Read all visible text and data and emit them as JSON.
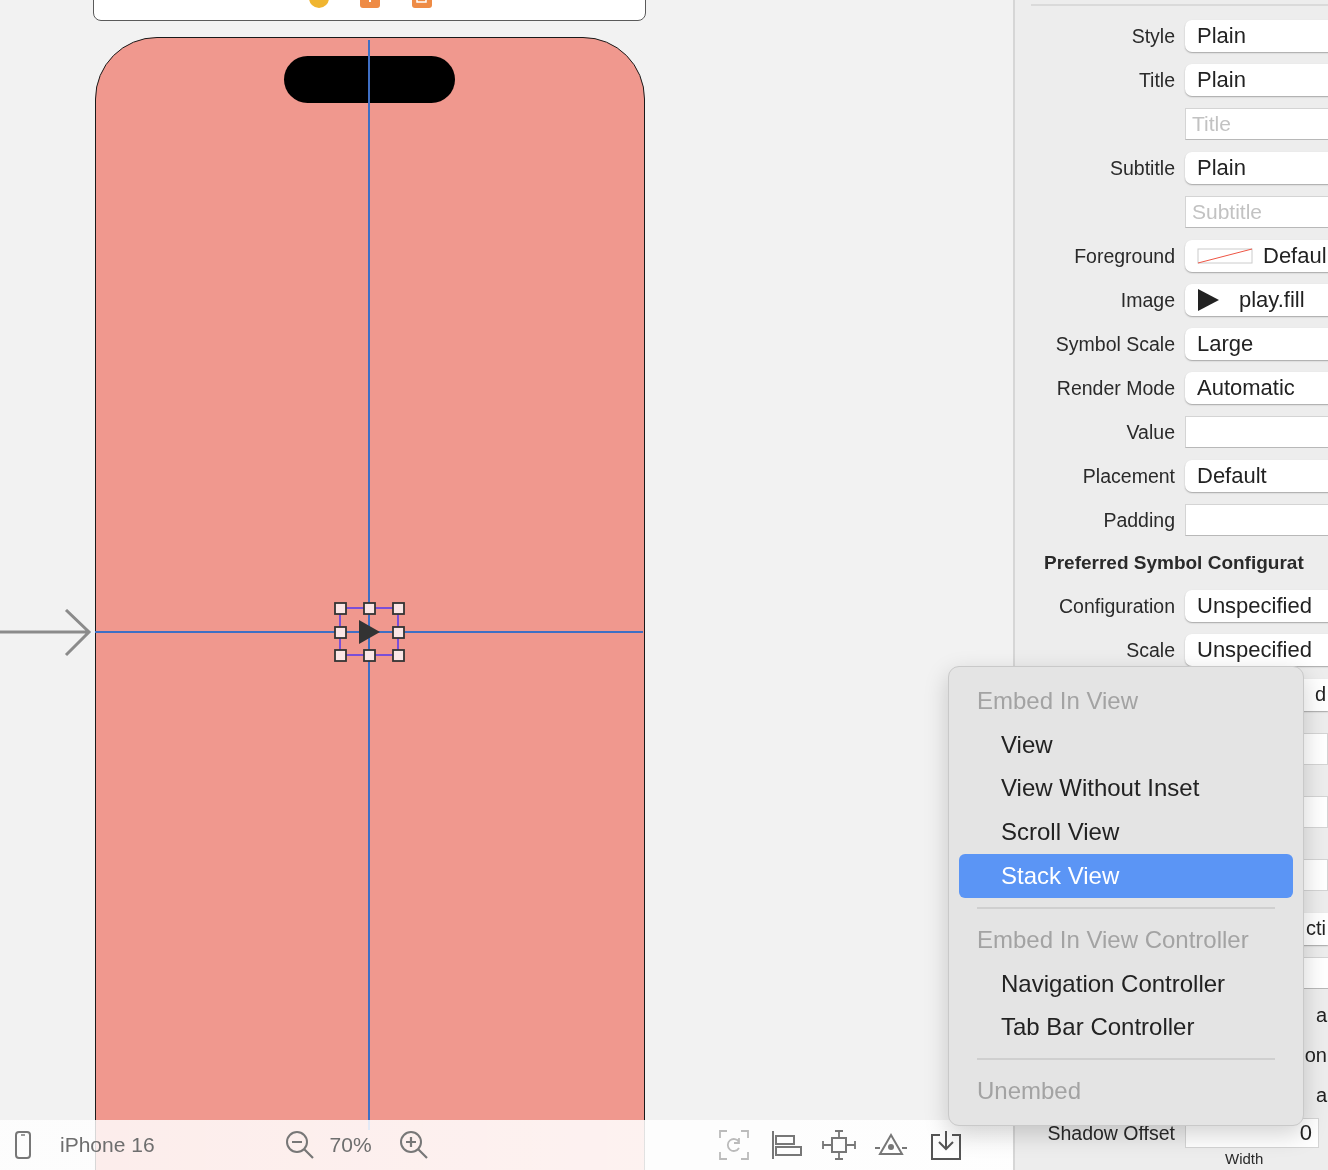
{
  "device": {
    "name": "iPhone 16",
    "zoom": "70%"
  },
  "inspector": {
    "rows": [
      {
        "kind": "popup",
        "label": "Style",
        "value": "Plain"
      },
      {
        "kind": "popup",
        "label": "Title",
        "value": "Plain"
      },
      {
        "kind": "text",
        "placeholder": "Title"
      },
      {
        "kind": "popup",
        "label": "Subtitle",
        "value": "Plain"
      },
      {
        "kind": "text",
        "placeholder": "Subtitle"
      },
      {
        "kind": "color",
        "label": "Foreground",
        "value": "Defaul"
      },
      {
        "kind": "image",
        "label": "Image",
        "value": "play.fill"
      },
      {
        "kind": "popup",
        "label": "Symbol Scale",
        "value": "Large"
      },
      {
        "kind": "popup",
        "label": "Render Mode",
        "value": "Automatic"
      },
      {
        "kind": "text",
        "label": "Value"
      },
      {
        "kind": "popup",
        "label": "Placement",
        "value": "Default"
      },
      {
        "kind": "text",
        "label": "Padding"
      },
      {
        "kind": "heading",
        "label": "Preferred Symbol Configurat"
      },
      {
        "kind": "popup",
        "label": "Configuration",
        "value": "Unspecified"
      },
      {
        "kind": "popup",
        "label": "Scale",
        "value": "Unspecified"
      },
      {
        "kind": "tail",
        "value": "d"
      },
      {
        "kind": "blank"
      },
      {
        "kind": "blank"
      },
      {
        "kind": "blank"
      },
      {
        "kind": "tail",
        "value": "cti"
      },
      {
        "kind": "text"
      },
      {
        "kind": "note",
        "value": "a"
      },
      {
        "kind": "note",
        "value": "on"
      },
      {
        "kind": "note",
        "value": "a"
      },
      {
        "kind": "offset",
        "label": "Shadow Offset",
        "value": "0"
      },
      {
        "kind": "caption",
        "value": "Width"
      }
    ]
  },
  "menu": {
    "items": [
      {
        "kind": "header",
        "label": "Embed In View"
      },
      {
        "kind": "item",
        "label": "View",
        "selected": false,
        "disabled": false
      },
      {
        "kind": "item",
        "label": "View Without Inset",
        "selected": false,
        "disabled": false
      },
      {
        "kind": "item",
        "label": "Scroll View",
        "selected": false,
        "disabled": false
      },
      {
        "kind": "item",
        "label": "Stack View",
        "selected": true,
        "disabled": false
      },
      {
        "kind": "separator"
      },
      {
        "kind": "header",
        "label": "Embed In View Controller"
      },
      {
        "kind": "item",
        "label": "Navigation Controller",
        "selected": false,
        "disabled": false
      },
      {
        "kind": "item",
        "label": "Tab Bar Controller",
        "selected": false,
        "disabled": false
      },
      {
        "kind": "separator"
      },
      {
        "kind": "item",
        "label": "Unembed",
        "selected": false,
        "disabled": true
      }
    ]
  }
}
